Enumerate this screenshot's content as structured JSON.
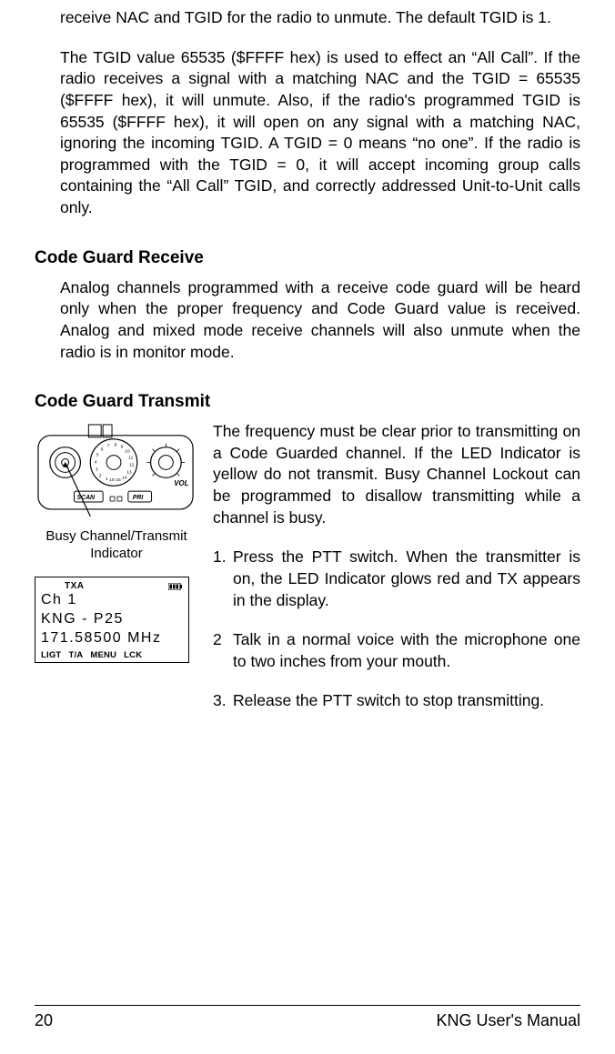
{
  "intro_para1": "receive NAC and TGID for the radio to unmute. The default TGID is 1.",
  "intro_para2": "The TGID value 65535 ($FFFF hex) is used to effect an “All Call”. If the radio receives a signal with a matching NAC and the TGID = 65535 ($FFFF hex), it will unmute. Also, if the radio's programmed TGID is 65535 ($FFFF hex), it will open on any signal with a matching NAC, ignoring the incoming TGID.  A TGID = 0 means “no one”. If the radio is programmed with the TGID = 0, it will accept incoming group calls containing the “All Call” TGID, and correctly addressed Unit-to-Unit calls only.",
  "section1": {
    "heading": "Code Guard Receive",
    "body": "Analog channels programmed with a receive code guard will be heard only when the proper frequency and Code Guard value is received. Analog and mixed mode receive channels will also unmute when the radio is in monitor mode."
  },
  "section2": {
    "heading": "Code Guard Transmit",
    "caption_line1": "Busy Channel/Transmit",
    "caption_line2": "Indicator",
    "body1": "The frequency must be clear prior to transmitting on a Code Guarded channel. If the LED Indicator is yellow do not transmit. Busy Channel Lockout can be programmed to disallow transmitting while a channel is busy.",
    "steps": {
      "s1_num": "1.",
      "s1": "Press the PTT switch. When the transmitter is on, the LED Indicator glows red and TX appears in the display.",
      "s2_num": "2",
      "s2": "Talk in a normal voice with the microphone one to two inches from your mouth.",
      "s3_num": "3.",
      "s3": "Release the PTT switch to stop transmitting."
    }
  },
  "lcd": {
    "txa": "TXA",
    "line1": "Ch 1",
    "line2": "KNG - P25",
    "line3": "171.58500 MHz",
    "soft1": "LIGT",
    "soft2": "T/A",
    "soft3": "MENU",
    "soft4": "LCK"
  },
  "radio": {
    "vol_label": "VOL",
    "scan_label": "SCAN",
    "pri_label": "PRI",
    "dial_numbers": [
      "1",
      "2",
      "3",
      "4",
      "5",
      "6",
      "7",
      "8",
      "9",
      "10",
      "11",
      "12",
      "13",
      "14",
      "15",
      "16"
    ]
  },
  "footer": {
    "page": "20",
    "title": "KNG User's Manual"
  }
}
